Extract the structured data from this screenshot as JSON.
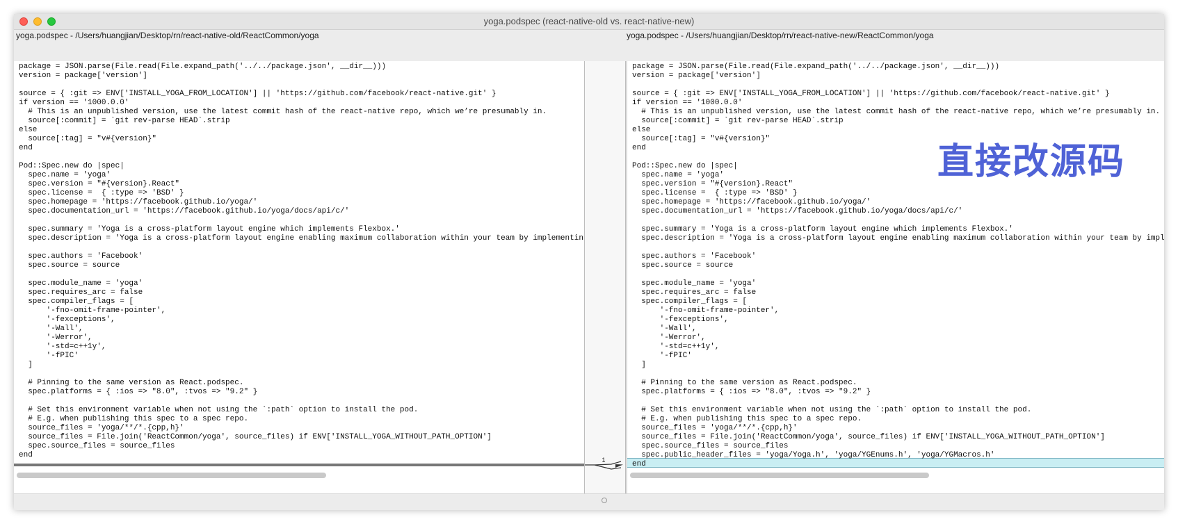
{
  "window": {
    "title": "yoga.podspec (react-native-old vs. react-native-new)"
  },
  "left_pane": {
    "path": "yoga.podspec - /Users/huangjian/Desktop/rn/react-native-old/ReactCommon/yoga",
    "lines": [
      "package = JSON.parse(File.read(File.expand_path('../../package.json', __dir__)))",
      "version = package['version']",
      "",
      "source = { :git => ENV['INSTALL_YOGA_FROM_LOCATION'] || 'https://github.com/facebook/react-native.git' }",
      "if version == '1000.0.0'",
      "  # This is an unpublished version, use the latest commit hash of the react-native repo, which we’re presumably in.",
      "  source[:commit] = `git rev-parse HEAD`.strip",
      "else",
      "  source[:tag] = \"v#{version}\"",
      "end",
      "",
      "Pod::Spec.new do |spec|",
      "  spec.name = 'yoga'",
      "  spec.version = \"#{version}.React\"",
      "  spec.license =  { :type => 'BSD' }",
      "  spec.homepage = 'https://facebook.github.io/yoga/'",
      "  spec.documentation_url = 'https://facebook.github.io/yoga/docs/api/c/'",
      "",
      "  spec.summary = 'Yoga is a cross-platform layout engine which implements Flexbox.'",
      "  spec.description = 'Yoga is a cross-platform layout engine enabling maximum collaboration within your team by implementin",
      "",
      "  spec.authors = 'Facebook'",
      "  spec.source = source",
      "",
      "  spec.module_name = 'yoga'",
      "  spec.requires_arc = false",
      "  spec.compiler_flags = [",
      "      '-fno-omit-frame-pointer',",
      "      '-fexceptions',",
      "      '-Wall',",
      "      '-Werror',",
      "      '-std=c++1y',",
      "      '-fPIC'",
      "  ]",
      "",
      "  # Pinning to the same version as React.podspec.",
      "  spec.platforms = { :ios => \"8.0\", :tvos => \"9.2\" }",
      "",
      "  # Set this environment variable when not using the `:path` option to install the pod.",
      "  # E.g. when publishing this spec to a spec repo.",
      "  source_files = 'yoga/**/*.{cpp,h}'",
      "  source_files = File.join('ReactCommon/yoga', source_files) if ENV['INSTALL_YOGA_WITHOUT_PATH_OPTION']",
      "  spec.source_files = source_files",
      "end"
    ]
  },
  "right_pane": {
    "path": "yoga.podspec - /Users/huangjian/Desktop/rn/react-native-new/ReactCommon/yoga",
    "lines": [
      "package = JSON.parse(File.read(File.expand_path('../../package.json', __dir__)))",
      "version = package['version']",
      "",
      "source = { :git => ENV['INSTALL_YOGA_FROM_LOCATION'] || 'https://github.com/facebook/react-native.git' }",
      "if version == '1000.0.0'",
      "  # This is an unpublished version, use the latest commit hash of the react-native repo, which we’re presumably in.",
      "  source[:commit] = `git rev-parse HEAD`.strip",
      "else",
      "  source[:tag] = \"v#{version}\"",
      "end",
      "",
      "Pod::Spec.new do |spec|",
      "  spec.name = 'yoga'",
      "  spec.version = \"#{version}.React\"",
      "  spec.license =  { :type => 'BSD' }",
      "  spec.homepage = 'https://facebook.github.io/yoga/'",
      "  spec.documentation_url = 'https://facebook.github.io/yoga/docs/api/c/'",
      "",
      "  spec.summary = 'Yoga is a cross-platform layout engine which implements Flexbox.'",
      "  spec.description = 'Yoga is a cross-platform layout engine enabling maximum collaboration within your team by impl",
      "",
      "  spec.authors = 'Facebook'",
      "  spec.source = source",
      "",
      "  spec.module_name = 'yoga'",
      "  spec.requires_arc = false",
      "  spec.compiler_flags = [",
      "      '-fno-omit-frame-pointer',",
      "      '-fexceptions',",
      "      '-Wall',",
      "      '-Werror',",
      "      '-std=c++1y',",
      "      '-fPIC'",
      "  ]",
      "",
      "  # Pinning to the same version as React.podspec.",
      "  spec.platforms = { :ios => \"8.0\", :tvos => \"9.2\" }",
      "",
      "  # Set this environment variable when not using the `:path` option to install the pod.",
      "  # E.g. when publishing this spec to a spec repo.",
      "  source_files = 'yoga/**/*.{cpp,h}'",
      "  source_files = File.join('ReactCommon/yoga', source_files) if ENV['INSTALL_YOGA_WITHOUT_PATH_OPTION']",
      "  spec.source_files = source_files",
      "  spec.public_header_files = 'yoga/Yoga.h', 'yoga/YGEnums.h', 'yoga/YGMacros.h'",
      "end"
    ],
    "added_line_index": 43
  },
  "gutter": {
    "change_number": "1"
  },
  "annotation": {
    "text": "直接改源码",
    "color": "#4f62d6"
  },
  "colors": {
    "added_highlight": "#c9eef3",
    "change_marker": "#777777"
  }
}
